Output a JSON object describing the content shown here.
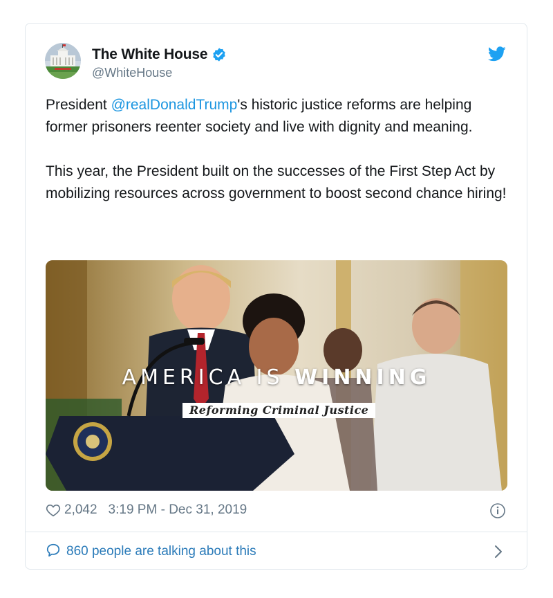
{
  "tweet": {
    "display_name": "The White House",
    "handle": "@WhiteHouse",
    "paragraph1": {
      "before": "President ",
      "mention": "@realDonaldTrump",
      "after": "'s historic justice reforms are helping former prisoners reenter society and live with dignity and meaning."
    },
    "paragraph2": "This year, the President built on the successes of the First Step Act by mobilizing resources across government to boost second chance hiring!",
    "media": {
      "headline_light": "AMERICA IS ",
      "headline_bold": "WINNING",
      "subtitle": "Reforming Criminal Justice"
    },
    "likes": "2,042",
    "timestamp": "3:19 PM - Dec 31, 2019",
    "talking": "860 people are talking about this"
  },
  "colors": {
    "link": "#1b95e0",
    "secondary_text": "#657786",
    "verified": "#1da1f2",
    "border": "#e1e8ed"
  },
  "icons": [
    "verified-badge-icon",
    "twitter-bird-icon",
    "heart-icon",
    "info-icon",
    "comment-bubble-icon",
    "chevron-right-icon"
  ]
}
